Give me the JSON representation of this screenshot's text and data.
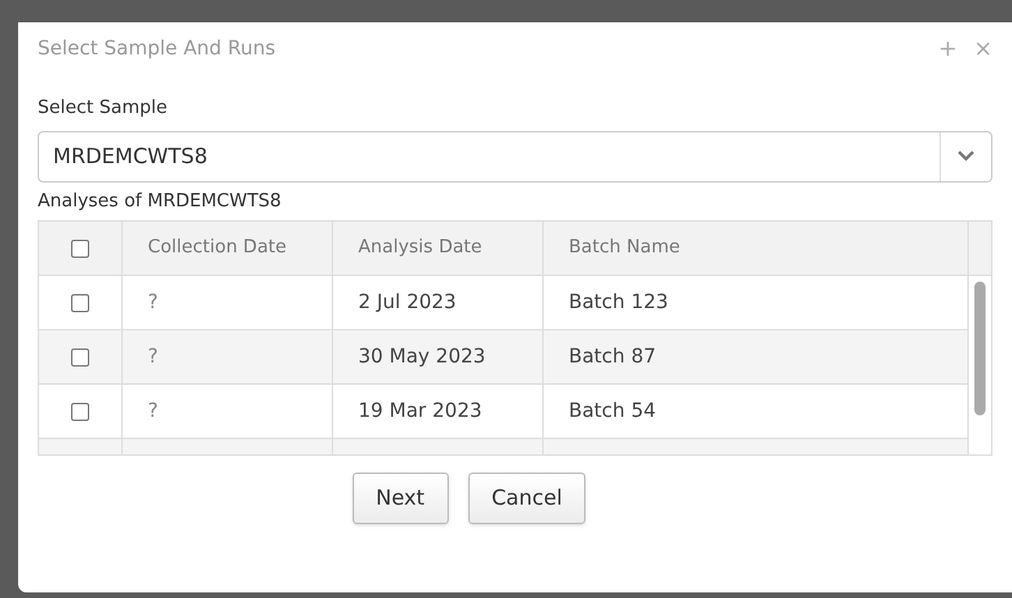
{
  "dialog": {
    "title": "Select Sample And Runs",
    "controls": [
      "+",
      "×"
    ]
  },
  "sample_field": {
    "label": "Select Sample",
    "value": "MRDEMCWTS8"
  },
  "table": {
    "caption": "Analyses of MRDEMCWTS8",
    "select_all_checked": false,
    "columns": [
      "Collection Date",
      "Analysis Date",
      "Batch Name"
    ],
    "rows": [
      {
        "checked": false,
        "cells": [
          "?",
          "2 Jul 2023",
          "Batch 123"
        ]
      },
      {
        "checked": false,
        "cells": [
          "?",
          "30 May 2023",
          "Batch 87"
        ]
      },
      {
        "checked": false,
        "cells": [
          "?",
          "19 Mar 2023",
          "Batch 54"
        ]
      }
    ]
  },
  "buttons": [
    "Next",
    "Cancel"
  ]
}
